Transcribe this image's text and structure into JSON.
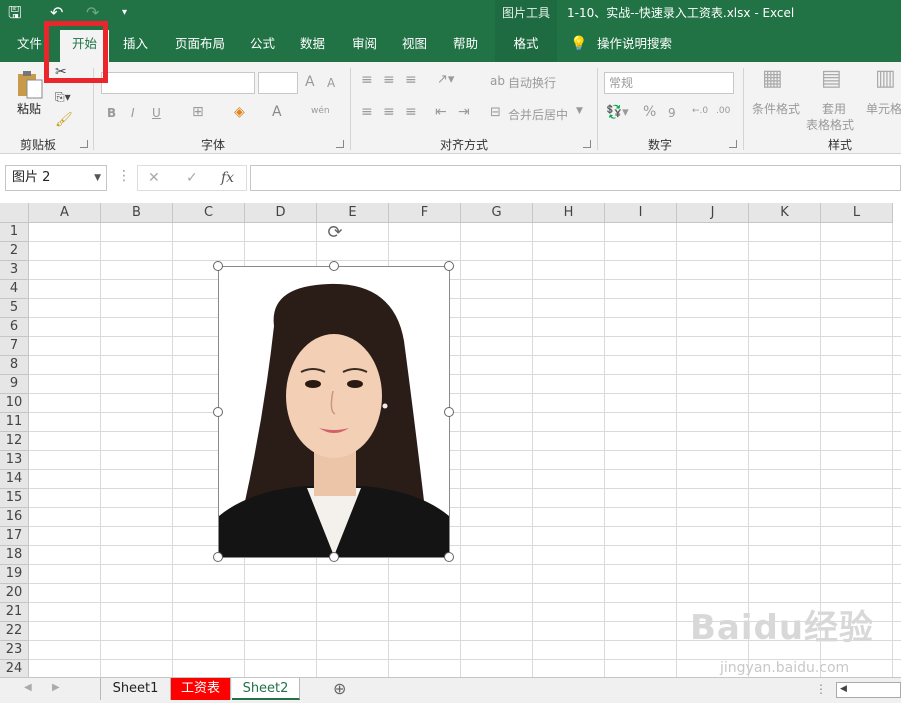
{
  "title_bar": {
    "quick_access": {
      "save": "🖫",
      "undo": "↶",
      "redo": "↷",
      "customize": "▾"
    },
    "context_tool_label": "图片工具",
    "window_title": "1-10、实战--快速录入工资表.xlsx  -  Excel"
  },
  "tabs": {
    "file": "文件",
    "home": "开始",
    "insert": "插入",
    "page_layout": "页面布局",
    "formulas": "公式",
    "data": "数据",
    "review": "审阅",
    "view": "视图",
    "help": "帮助",
    "format": "格式",
    "tell_me": "操作说明搜索"
  },
  "ribbon": {
    "clipboard": {
      "paste": "粘贴",
      "label": "剪贴板"
    },
    "font": {
      "label": "字体",
      "bold": "B",
      "italic": "I",
      "underline": "U",
      "font_grow": "A",
      "font_shrink": "A",
      "font_color": "A",
      "phonetic": "wén"
    },
    "alignment": {
      "wrap_text": "自动换行",
      "merge_center": "合并后居中",
      "label": "对齐方式"
    },
    "number": {
      "format_value": "常规",
      "percent": "%",
      "comma": "9",
      "inc_decimal": ".00",
      "label": "数字"
    },
    "styles": {
      "conditional": "条件格式",
      "table_style_1": "套用",
      "table_style_2": "表格格式",
      "cell_style": "单元格",
      "label": "样式"
    }
  },
  "formula_bar": {
    "name_box": "图片 2",
    "cancel": "✕",
    "enter": "✓",
    "fx": "fx",
    "formula_value": ""
  },
  "columns": [
    "A",
    "B",
    "C",
    "D",
    "E",
    "F",
    "G",
    "H",
    "I",
    "J",
    "K",
    "L"
  ],
  "rows": [
    "1",
    "2",
    "3",
    "4",
    "5",
    "6",
    "7",
    "8",
    "9",
    "10",
    "11",
    "12",
    "13",
    "14",
    "15",
    "16",
    "17",
    "18",
    "19",
    "20",
    "21",
    "22",
    "23",
    "24"
  ],
  "sheets": [
    {
      "name": "Sheet1",
      "active": false
    },
    {
      "name": "工资表",
      "active": false,
      "color": "#ff0000"
    },
    {
      "name": "Sheet2",
      "active": true
    }
  ],
  "sheet_add": "⊕",
  "watermark": {
    "main": "Baidu经验",
    "sub": "jingyan.baidu.com"
  },
  "colors": {
    "excel_green": "#217346",
    "highlight_red": "#e8262c",
    "sheet_tab_red": "#ff0000"
  }
}
